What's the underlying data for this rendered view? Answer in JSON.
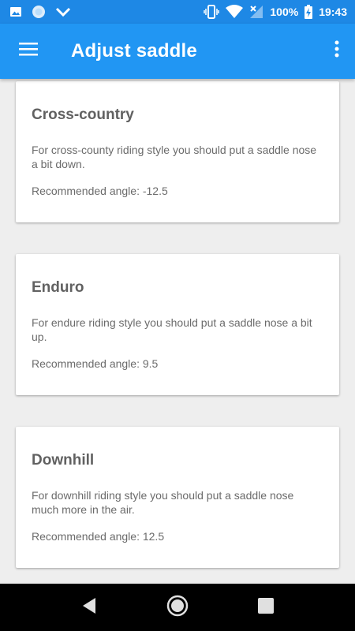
{
  "status_bar": {
    "battery": "100%",
    "time": "19:43",
    "icons": [
      "image-icon",
      "circle-icon",
      "chevron-down-icon",
      "vibrate-icon",
      "wifi-icon",
      "no-signal-icon",
      "battery-charging-icon"
    ]
  },
  "app_bar": {
    "title": "Adjust saddle",
    "menu_icon": "hamburger-menu-icon",
    "overflow_icon": "more-vert-icon"
  },
  "cards": [
    {
      "title": "Cross-country",
      "description": "For cross-county riding style you should put a saddle nose a bit down.",
      "angle": "Recommended angle: -12.5"
    },
    {
      "title": "Enduro",
      "description": "For endure riding style you should put a saddle nose a bit up.",
      "angle": "Recommended angle: 9.5"
    },
    {
      "title": "Downhill",
      "description": "For downhill riding style you should put a saddle nose much more in the air.",
      "angle": "Recommended angle: 12.5"
    }
  ],
  "nav_bar": {
    "icons": [
      "back-icon",
      "home-icon",
      "recents-icon"
    ]
  },
  "colors": {
    "status_bar": "#1e88e5",
    "app_bar": "#2196f3",
    "background": "#eeeeee",
    "card": "#ffffff"
  }
}
